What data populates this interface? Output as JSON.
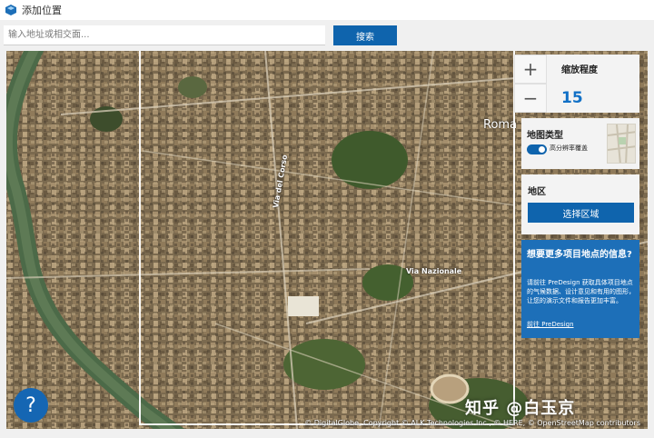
{
  "window": {
    "title": "添加位置"
  },
  "search": {
    "placeholder": "输入地址或相交面...",
    "button_label": "搜索"
  },
  "zoom": {
    "plus_symbol": "+",
    "minus_symbol": "−",
    "label": "缩放程度",
    "value": "15"
  },
  "map_type": {
    "label": "地图类型",
    "toggle_label": "高分辨率覆盖"
  },
  "region": {
    "label": "地区",
    "button_label": "选择区域"
  },
  "promo": {
    "title": "想要更多项目地点的信息?",
    "body": "请前往 PreDesign 获取具体项目地点的气候数据、设计意见和有用的图形，让您的演示文件和报告更加丰富。",
    "link": "前往 PreDesign"
  },
  "help": {
    "symbol": "?"
  },
  "map": {
    "labels": {
      "roma": "Roma",
      "via_nazionale": "Via Nazionale",
      "via_del_corso": "Via del Corso"
    },
    "attribution": "© DigitalGlobe, Copyright © ALK Technologies Inc., © HERE, © OpenStreetMap contributors"
  },
  "watermark": "知乎 @白玉京",
  "colors": {
    "accent_blue": "#0f64ad",
    "promo_blue": "#1d6fb8",
    "zoom_value_blue": "#1170c6",
    "panel_bg": "#f3f3f3"
  }
}
